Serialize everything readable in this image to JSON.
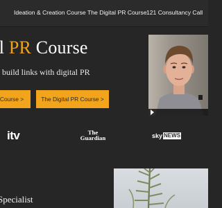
{
  "nav": {
    "items": [
      {
        "label": "Ideation & Creation Course"
      },
      {
        "label": "The Digital PR Course"
      },
      {
        "label": "121 Consultancy Call"
      }
    ]
  },
  "hero": {
    "title_prefix": "al ",
    "title_accent": "PR",
    "title_suffix": " Course",
    "subtitle": "o build links with digital PR",
    "buttons": [
      {
        "label": "Course >"
      },
      {
        "label": "The Digital PR Course >"
      }
    ]
  },
  "logos": {
    "itv": "itv",
    "guardian_line1": "The",
    "guardian_line2": "Guardian",
    "sky": "sky",
    "sky_news": "NEWS"
  },
  "section": {
    "heading": "Specialist"
  },
  "colors": {
    "accent": "#f0a41e",
    "button": "#f2a51c",
    "background": "#262626",
    "nav": "#2b2b2b"
  }
}
